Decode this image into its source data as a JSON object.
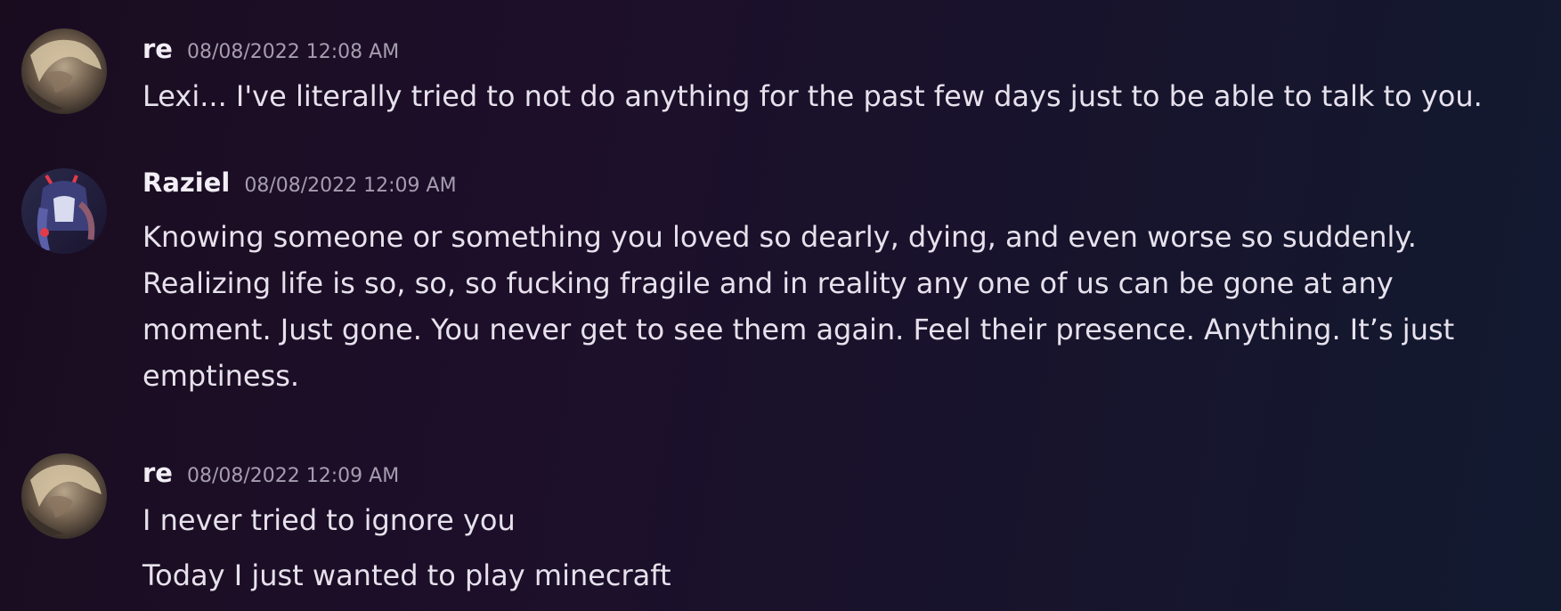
{
  "messages": [
    {
      "username": "re",
      "timestamp": "08/08/2022 12:08 AM",
      "avatar_icon": "user-avatar-re",
      "lines": [
        "Lexi... I've literally tried to not do anything for the past few days just to be able to talk to you."
      ]
    },
    {
      "username": "Raziel",
      "timestamp": "08/08/2022 12:09 AM",
      "avatar_icon": "user-avatar-raziel",
      "lines": [
        "Knowing someone or something you loved so dearly, dying, and even worse so suddenly.",
        "Realizing life is so, so, so fucking fragile and in reality any one of us can be gone at any",
        "moment. Just gone. You never get to see them again. Feel their presence. Anything. It’s just",
        "emptiness."
      ]
    },
    {
      "username": "re",
      "timestamp": "08/08/2022 12:09 AM",
      "avatar_icon": "user-avatar-re",
      "lines": [
        "I never tried to ignore you",
        "Today I just wanted to play minecraft"
      ]
    }
  ]
}
